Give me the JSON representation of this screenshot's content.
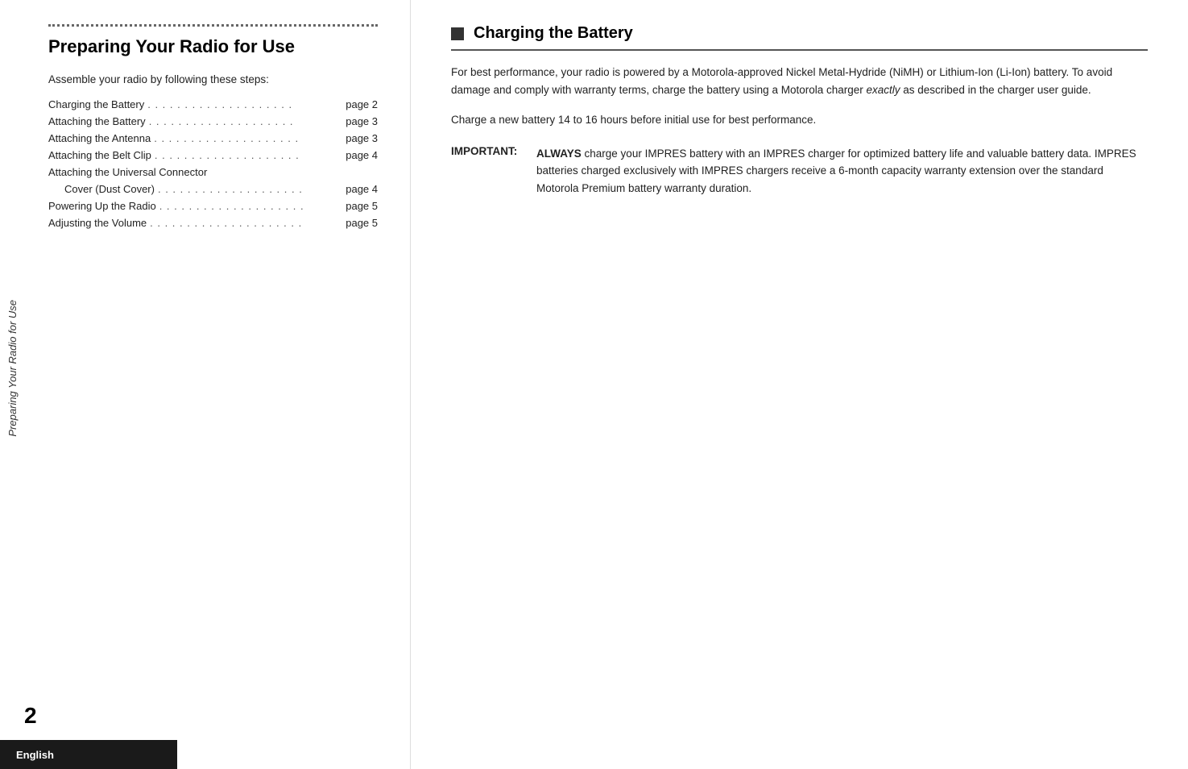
{
  "sidebar": {
    "label": "Preparing Your Radio for Use"
  },
  "page_number": "2",
  "language": "English",
  "left_column": {
    "heading": "Preparing Your Radio for Use",
    "intro": "Assemble your radio by following these steps:",
    "toc": [
      {
        "label": "Charging the Battery",
        "dots": ". . . . . . . . . . . . . . . . . . . . .",
        "page": "page 2",
        "indented": false
      },
      {
        "label": "Attaching the Battery",
        "dots": ". . . . . . . . . . . . . . . . . . . . .",
        "page": "page 3",
        "indented": false
      },
      {
        "label": "Attaching the Antenna",
        "dots": ". . . . . . . . . . . . . . . . . . . . .",
        "page": "page 3",
        "indented": false
      },
      {
        "label": "Attaching the Belt Clip",
        "dots": ". . . . . . . . . . . . . . . . . . . . .",
        "page": "page 4",
        "indented": false
      },
      {
        "label": "Attaching the Universal Connector",
        "dots": "",
        "page": "",
        "indented": false
      },
      {
        "label": "Cover (Dust Cover)",
        "dots": ". . . . . . . . . . . . . . . . . . . . .",
        "page": "page 4",
        "indented": true
      },
      {
        "label": "Powering Up the Radio",
        "dots": ". . . . . . . . . . . . . . . . . . . . .",
        "page": "page 5",
        "indented": false
      },
      {
        "label": "Adjusting the Volume",
        "dots": ". . . . . . . . . . . . . . . . . . . . . .",
        "page": "page 5",
        "indented": false
      }
    ]
  },
  "right_column": {
    "heading": "Charging the Battery",
    "paragraph1": "For best performance, your radio is powered by a Motorola-approved Nickel Metal-Hydride (NiMH) or Lithium-Ion (Li-Ion) battery. To avoid damage and comply with warranty terms, charge the battery using a Motorola charger exactly as described in the charger user guide.",
    "paragraph1_italic_word": "exactly",
    "paragraph2": "Charge a new battery 14 to 16 hours before initial use for best performance.",
    "important_label": "IMPORTANT:",
    "important_bold": "ALWAYS",
    "important_text": " charge your IMPRES battery with an IMPRES charger for optimized battery life and valuable battery data. IMPRES batteries charged exclusively with IMPRES chargers receive a 6-month capacity warranty extension over the standard Motorola Premium battery warranty duration."
  }
}
